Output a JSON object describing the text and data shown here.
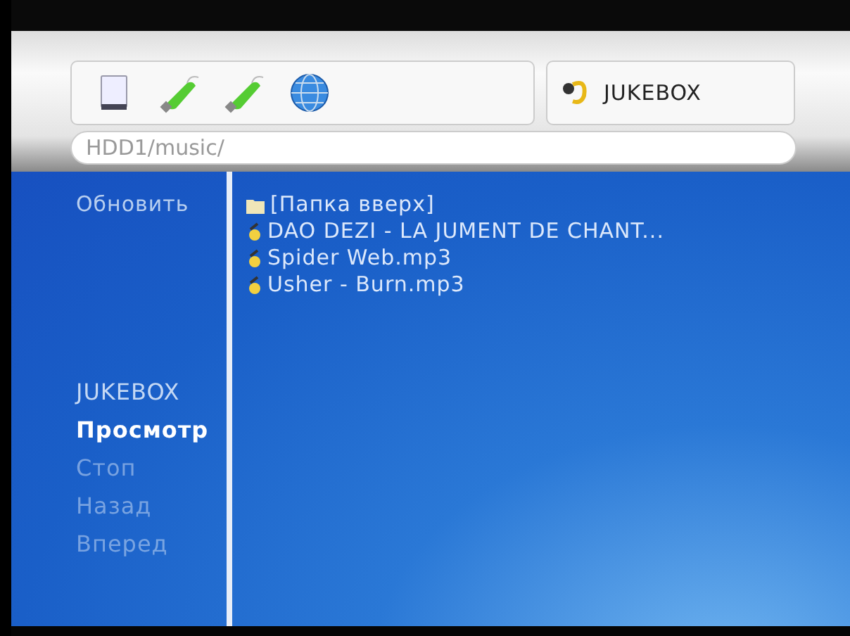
{
  "devices": [
    {
      "kind": "hdd"
    },
    {
      "kind": "usb"
    },
    {
      "kind": "usb"
    },
    {
      "kind": "network"
    }
  ],
  "mode": {
    "label": "JUKEBOX"
  },
  "path": {
    "value": "HDD1/music/"
  },
  "sidebar": {
    "top_action": "Обновить",
    "items": [
      {
        "label": "JUKEBOX",
        "selected": false,
        "disabled": false
      },
      {
        "label": "Просмотр",
        "selected": true,
        "disabled": false
      },
      {
        "label": "Стоп",
        "selected": false,
        "disabled": true
      },
      {
        "label": "Назад",
        "selected": false,
        "disabled": true
      },
      {
        "label": "Вперед",
        "selected": false,
        "disabled": true
      }
    ]
  },
  "files": [
    {
      "kind": "folder",
      "name": "[Папка вверх]"
    },
    {
      "kind": "audio",
      "name": "DAO DEZI - LA JUMENT DE CHANT..."
    },
    {
      "kind": "audio",
      "name": "Spider Web.mp3"
    },
    {
      "kind": "audio",
      "name": "Usher - Burn.mp3"
    }
  ]
}
